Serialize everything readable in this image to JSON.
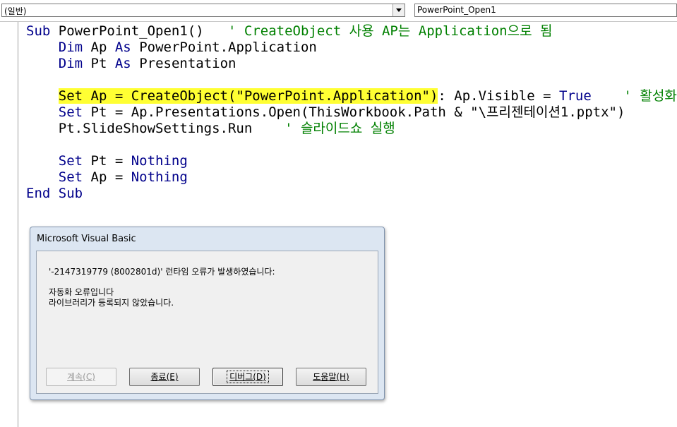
{
  "toolbar": {
    "object_combo": "(일반)",
    "procedure_combo": "PowerPoint_Open1"
  },
  "code_lines": {
    "l1": {
      "kw1": "Sub",
      "text": " PowerPoint_Open1()   ",
      "comment": "' CreateObject 사용 AP는 Application으로 됨"
    },
    "l2": {
      "kw1": "Dim",
      "t1": " Ap ",
      "kw2": "As",
      "t2": " PowerPoint.Application"
    },
    "l3": {
      "kw1": "Dim",
      "t1": " Pt ",
      "kw2": "As",
      "t2": " Presentation"
    },
    "l5": {
      "highlighted": "Set Ap = CreateObject(\"PowerPoint.Application\")",
      "t1": ": Ap.Visible = ",
      "kw": "True",
      "comment": "' 활성화"
    },
    "l6": {
      "kw": "Set",
      "text": " Pt = Ap.Presentations.Open(ThisWorkbook.Path & \"\\프리젠테이션1.pptx\")"
    },
    "l7": {
      "text": "Pt.SlideShowSettings.Run    ",
      "comment": "' 슬라이드쇼 실행"
    },
    "l9": {
      "kw1": "Set",
      "t1": " Pt = ",
      "kw2": "Nothing"
    },
    "l10": {
      "kw1": "Set",
      "t1": " Ap = ",
      "kw2": "Nothing"
    },
    "l11": {
      "kw": "End Sub"
    }
  },
  "dialog": {
    "title": "Microsoft Visual Basic",
    "error_line": "'-2147319779 (8002801d)' 런타임 오류가 발생하였습니다:",
    "message_line1": "자동화 오류입니다",
    "message_line2": "라이브러리가 등록되지 않았습니다.",
    "buttons": {
      "continue": "계속(C)",
      "end": "종료(E)",
      "debug": "디버그(D)",
      "help": "도움말(H)"
    }
  },
  "colors": {
    "keyword": "#00008b",
    "comment": "#008000",
    "highlight": "#ffff33",
    "dialog_frame": "#dce6f2"
  }
}
